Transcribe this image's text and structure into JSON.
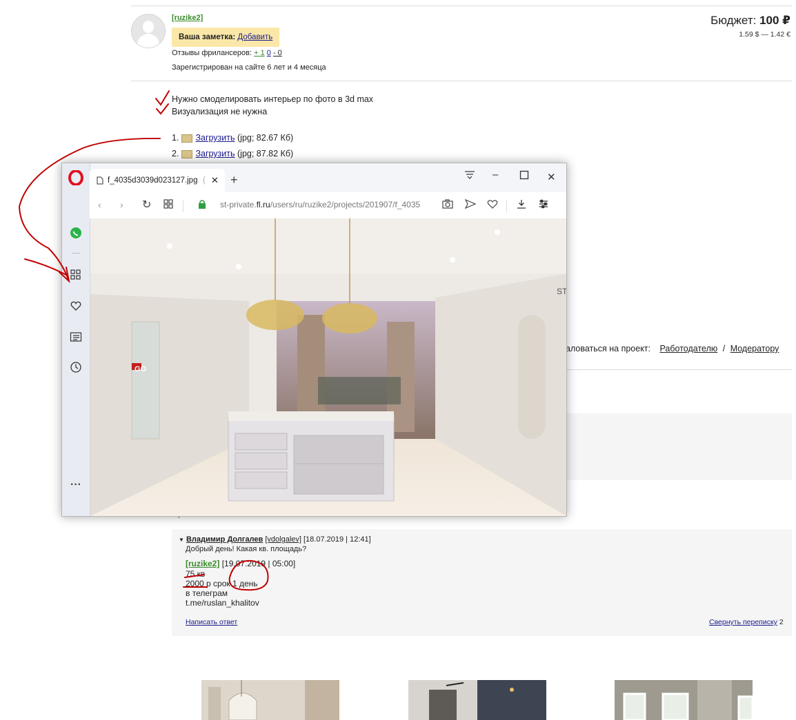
{
  "project": {
    "username": "[ruzike2]",
    "note_label": "Ваша заметка:",
    "note_add": "Добавить",
    "reviews_label": "Отзывы фрилансеров:",
    "reviews_pos": "+ 1",
    "reviews_neutral": "0",
    "reviews_neg": "- 0",
    "registered": "Зарегистрирован на сайте 6 лет и 4 месяца",
    "budget_label": "Бюджет:",
    "budget_value": "100 ₽",
    "budget_rates": "1.59 $ — 1.42 €",
    "desc_line1": "Нужно смоделировать интерьер по фото в 3d max",
    "desc_line2": "Визуализация не нужна",
    "files": [
      {
        "num": "1.",
        "link": "Загрузить",
        "meta": "(jpg; 82.67 Кб)"
      },
      {
        "num": "2.",
        "link": "Загрузить",
        "meta": "(jpg; 87.82 Кб)"
      }
    ],
    "complain_label": "аловаться на проект:",
    "complain_employer": "Работодателю",
    "complain_sep": "/",
    "complain_moderator": "Модератору",
    "cut_char": "р"
  },
  "browser": {
    "tab_title": "f_4035d3039d023127.jpg",
    "tab_title_tail": "(",
    "url_prefix": "st-private.",
    "url_domain": "fl.ru",
    "url_path": "/users/ru/ruzike2/projects/201907/f_4035",
    "sidebar_icons": [
      "opera-logo-icon",
      "whatsapp-icon",
      "speed-dial-icon",
      "heart-icon",
      "news-icon",
      "history-icon",
      "more-icon"
    ],
    "photo_text_left": "GO",
    "photo_text_right": "ST"
  },
  "comments": {
    "author": "Владимир Долгалев",
    "author_login": "[vdolgalev]",
    "author_date": "[18.07.2019 | 12:41]",
    "author_msg": "Добрый день! Какая кв. площадь?",
    "reply_login": "[ruzike2]",
    "reply_date": "[19.07.2019 | 05:00]",
    "reply_line1": "75 кв",
    "reply_line2": "2000 р срок 1 день",
    "reply_line3": "в телеграм",
    "reply_line4": "t.me/ruslan_khalitov",
    "write_reply": "Написать ответ",
    "collapse": "Свернуть переписку",
    "collapse_count": "2"
  },
  "colors": {
    "accent_link": "#1a1a8c",
    "green_link": "#3a8a2a",
    "note_bg": "#fbe8a9",
    "annotation_red": "#c00000"
  }
}
